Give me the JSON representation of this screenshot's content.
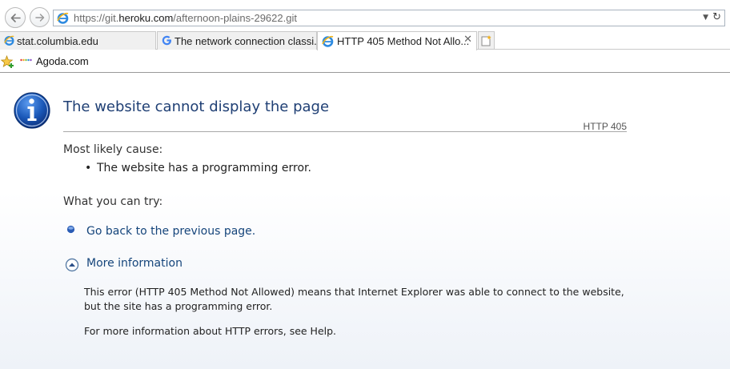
{
  "navigation": {
    "back_icon": "back-arrow-icon",
    "forward_icon": "forward-arrow-icon"
  },
  "address_bar": {
    "url_prefix": "https://git.",
    "url_domain": "heroku.com",
    "url_path": "/afternoon-plains-29622.git",
    "dropdown_icon": "chevron-down-icon",
    "refresh_icon": "refresh-icon"
  },
  "tabs": [
    {
      "label": "stat.columbia.edu",
      "icon": "ie-icon"
    },
    {
      "label": "The network connection classi...",
      "icon": "google-icon"
    },
    {
      "label": "HTTP 405 Method Not Allo...",
      "icon": "ie-icon",
      "active": true
    }
  ],
  "favorites_bar": {
    "items": [
      {
        "label": "Agoda.com",
        "icon": "agoda-logo-icon"
      }
    ]
  },
  "error_page": {
    "title": "The website cannot display the page",
    "code": "HTTP 405",
    "cause_heading": "Most likely cause:",
    "causes": [
      "The website has a programming error."
    ],
    "try_heading": "What you can try:",
    "back_link": "Go back to the previous page.",
    "more_info_link": "More information",
    "detail": "This error (HTTP 405 Method Not Allowed) means that Internet Explorer was able to connect to the website, but the site has a programming error.",
    "help": "For more information about HTTP errors, see Help."
  },
  "colors": {
    "title": "#1f3f74",
    "link": "#15457b",
    "info_icon": "#1a58b8"
  }
}
